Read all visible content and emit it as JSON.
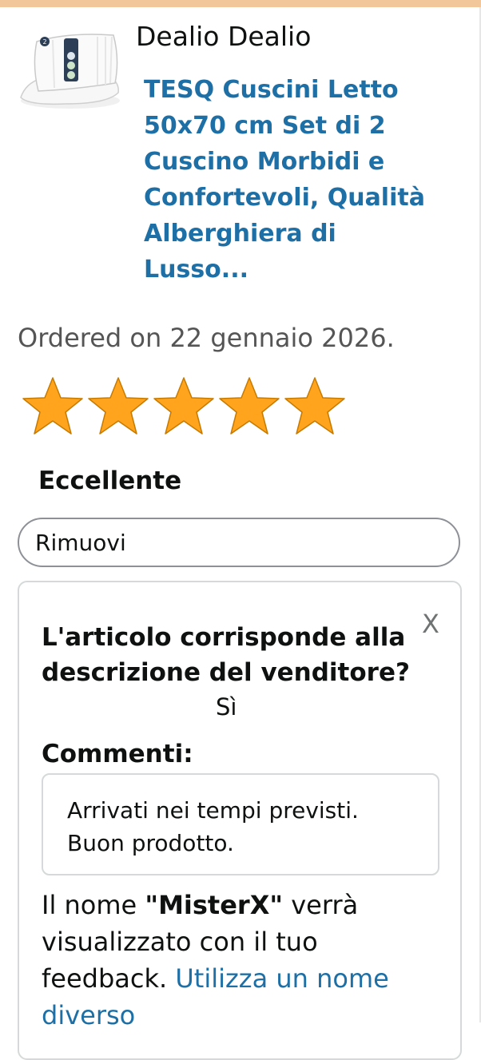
{
  "seller": {
    "name": "Dealio Dealio"
  },
  "product": {
    "title": "TESQ Cuscini Letto 50x70 cm Set di 2 Cuscino Morbidi e Confortevoli, Qualità Alberghiera di Lusso...",
    "image_icon": "pillow-product-image"
  },
  "order": {
    "ordered_text": "Ordered on 22 gennaio 2026."
  },
  "rating": {
    "stars": 5,
    "max": 5,
    "label": "Eccellente",
    "star_color": "#ffa41c"
  },
  "remove": {
    "label": "Rimuovi"
  },
  "feedback": {
    "close_label": "X",
    "question": "L'articolo corrisponde alla descrizione del venditore?",
    "answer": "Sì",
    "comments_label": "Commenti:",
    "comment_line1": "Arrivati nei tempi previsti.",
    "comment_line2": "Buon prodotto.",
    "name_prefix": "Il nome ",
    "name_value": "\"MisterX\"",
    "name_suffix": " verrà visualizzato con il tuo feedback. ",
    "name_link": "Utilizza un nome diverso"
  },
  "colors": {
    "link": "#1d6fa5",
    "accent_bar": "#f2c89a"
  }
}
